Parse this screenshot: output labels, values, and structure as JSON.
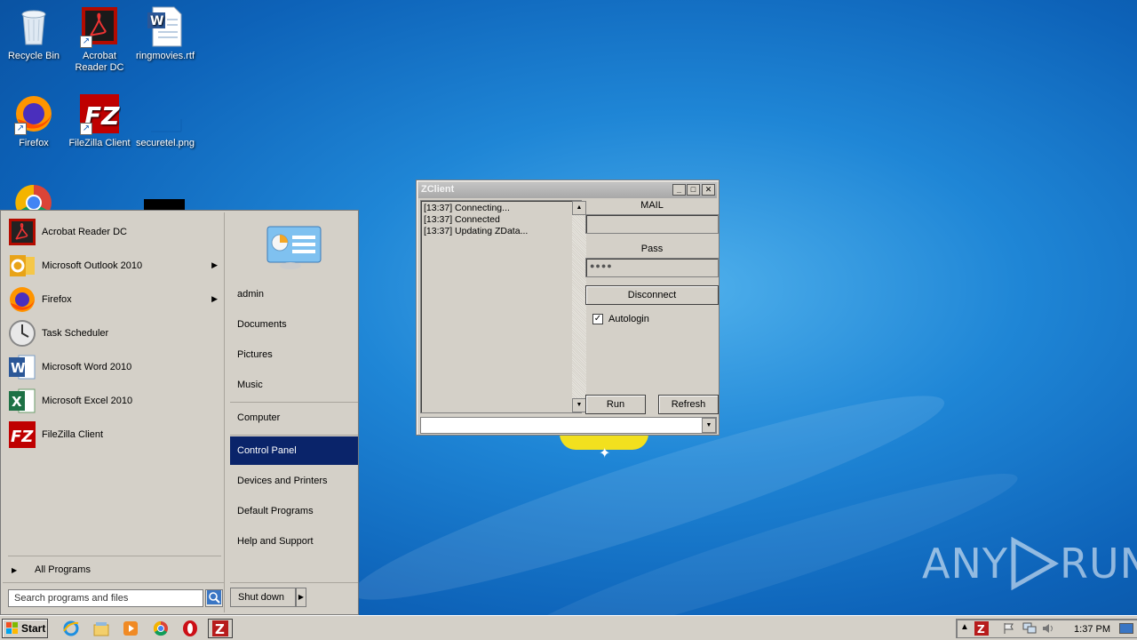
{
  "desktop": {
    "icons": [
      {
        "label": "Recycle Bin",
        "icon": "recycle-bin-icon"
      },
      {
        "label": "Acrobat Reader DC",
        "icon": "acrobat-icon"
      },
      {
        "label": "ringmovies.rtf",
        "icon": "word-document-icon"
      },
      {
        "label": "Firefox",
        "icon": "firefox-icon"
      },
      {
        "label": "FileZilla Client",
        "icon": "filezilla-icon"
      },
      {
        "label": "securetel.png",
        "icon": "image-file-icon"
      },
      {
        "label": "",
        "icon": "chrome-icon"
      }
    ]
  },
  "start_menu": {
    "programs": [
      {
        "label": "Acrobat Reader DC",
        "icon": "acrobat-icon",
        "has_submenu": false
      },
      {
        "label": "Microsoft Outlook 2010",
        "icon": "outlook-icon",
        "has_submenu": true
      },
      {
        "label": "Firefox",
        "icon": "firefox-icon",
        "has_submenu": true
      },
      {
        "label": "Task Scheduler",
        "icon": "task-scheduler-icon",
        "has_submenu": false
      },
      {
        "label": "Microsoft Word 2010",
        "icon": "word-icon",
        "has_submenu": false
      },
      {
        "label": "Microsoft Excel 2010",
        "icon": "excel-icon",
        "has_submenu": false
      },
      {
        "label": "FileZilla Client",
        "icon": "filezilla-icon",
        "has_submenu": false
      }
    ],
    "all_programs": "All Programs",
    "search_placeholder": "Search programs and files",
    "right_items": [
      {
        "label": "admin"
      },
      {
        "label": "Documents"
      },
      {
        "label": "Pictures"
      },
      {
        "label": "Music"
      },
      {
        "label": "Computer"
      },
      {
        "label": "Control Panel",
        "selected": true
      },
      {
        "label": "Devices and Printers"
      },
      {
        "label": "Default Programs"
      },
      {
        "label": "Help and Support"
      }
    ],
    "shutdown": "Shut down",
    "submenu_arrow": "▶"
  },
  "zclient": {
    "title": "ZClient",
    "log": [
      "[13:37] Connecting...",
      "[13:37] Connected",
      "[13:37] Updating ZData..."
    ],
    "mail_label": "MAIL",
    "mail_value": "",
    "pass_label": "Pass",
    "pass_value": "●●●●",
    "disconnect": "Disconnect",
    "autologin_label": "Autologin",
    "autologin_checked": true,
    "run": "Run",
    "refresh": "Refresh",
    "combo_value": ""
  },
  "taskbar": {
    "start_label": "Start",
    "apps": [
      "ie-icon",
      "explorer-icon",
      "media-player-icon",
      "chrome-icon",
      "opera-icon",
      "zclient-icon"
    ],
    "clock": "1:37 PM"
  },
  "watermark": {
    "left": "ANY",
    "right": "RUN"
  },
  "colors": {
    "selection": "#0a246a",
    "classic_face": "#d4d0c8",
    "desktop_blue": "#1f86d6"
  }
}
